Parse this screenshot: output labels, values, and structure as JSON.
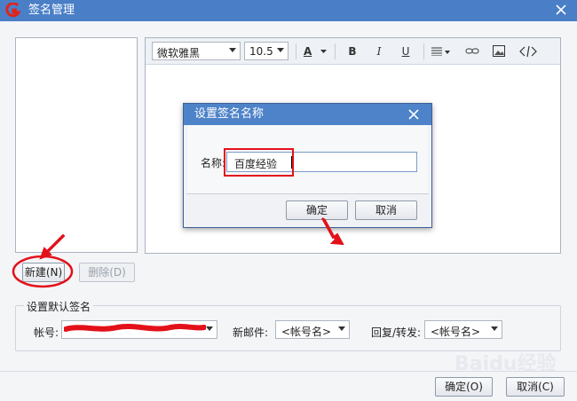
{
  "window": {
    "title": "签名管理"
  },
  "toolbar": {
    "font_family": "微软雅黑",
    "font_size": "10.5",
    "font_color_glyph": "A",
    "bold_glyph": "B",
    "italic_glyph": "I",
    "underline_glyph": "U"
  },
  "left_buttons": {
    "new_label": "新建(N)",
    "delete_label": "删除(D)"
  },
  "default_signature": {
    "group_title": "设置默认签名",
    "account_label": "帐号:",
    "new_mail_label": "新邮件:",
    "new_mail_value": "<帐号名>",
    "reply_label": "回复/转发:",
    "reply_value": "<帐号名>"
  },
  "bottom_buttons": {
    "ok_label": "确定(O)",
    "cancel_label": "取消(C)"
  },
  "dialog": {
    "title": "设置签名名称",
    "name_label": "名称:",
    "name_value": "百度经验",
    "ok_label": "确定",
    "cancel_label": "取消"
  },
  "watermark": "Baidu经验",
  "colors": {
    "titlebar": "#4a7fc7",
    "annotation": "#e3101a"
  }
}
